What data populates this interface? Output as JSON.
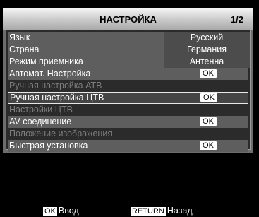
{
  "header": {
    "title": "НАСТРОЙКА",
    "page": "1/2"
  },
  "settings": {
    "language": {
      "label": "Язык",
      "value": "Русский"
    },
    "country": {
      "label": "Страна",
      "value": "Германия"
    },
    "receiver_mode": {
      "label": "Режим приемника",
      "value": "Антенна"
    },
    "auto_tuning": {
      "label": "Автомат. Настройка",
      "button": "OK"
    },
    "manual_atv": {
      "label": "Ручная настройка АТВ"
    },
    "manual_dtv": {
      "label": "Ручная настройка ЦТВ",
      "button": "OK"
    },
    "dtv_settings": {
      "label": "Настройки ЦТВ"
    },
    "av_connection": {
      "label": "AV-соединение",
      "button": "OK"
    },
    "image_position": {
      "label": "Положение изображения"
    },
    "quick_setup": {
      "label": "Быстрая установка",
      "button": "OK"
    }
  },
  "footer": {
    "ok_key": "OK",
    "ok_label": "Ввод",
    "return_key": "RETURN",
    "return_label": "Назад"
  }
}
